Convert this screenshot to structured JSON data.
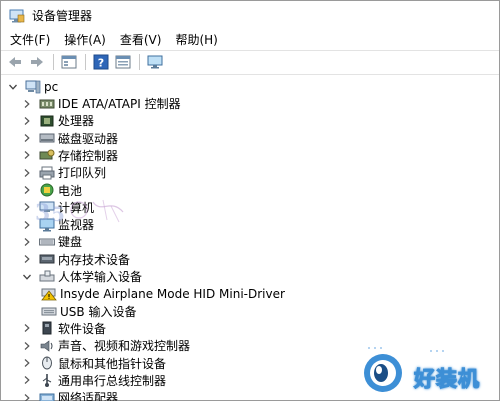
{
  "window": {
    "title": "设备管理器"
  },
  "menu": [
    "文件(F)",
    "操作(A)",
    "查看(V)",
    "帮助(H)"
  ],
  "toolbar": {
    "icons": [
      "back-arrow-icon",
      "forward-arrow-icon",
      "properties-icon",
      "help-icon",
      "view-icon",
      "monitor-icon"
    ]
  },
  "tree": {
    "root": "pc",
    "categories": [
      {
        "label": "IDE ATA/ATAPI 控制器",
        "icon": "ide-controller-icon",
        "expanded": false
      },
      {
        "label": "处理器",
        "icon": "processor-icon",
        "expanded": false
      },
      {
        "label": "磁盘驱动器",
        "icon": "disk-drive-icon",
        "expanded": false
      },
      {
        "label": "存储控制器",
        "icon": "storage-controller-icon",
        "expanded": false
      },
      {
        "label": "打印队列",
        "icon": "printer-icon",
        "expanded": false
      },
      {
        "label": "电池",
        "icon": "battery-icon",
        "expanded": false
      },
      {
        "label": "计算机",
        "icon": "computer-icon",
        "expanded": false
      },
      {
        "label": "监视器",
        "icon": "monitor-icon",
        "expanded": false
      },
      {
        "label": "键盘",
        "icon": "keyboard-icon",
        "expanded": false
      },
      {
        "label": "内存技术设备",
        "icon": "memory-icon",
        "expanded": false
      },
      {
        "label": "人体学输入设备",
        "icon": "hid-icon",
        "expanded": true
      },
      {
        "label": "软件设备",
        "icon": "software-device-icon",
        "expanded": false
      },
      {
        "label": "声音、视频和游戏控制器",
        "icon": "sound-icon",
        "expanded": false
      },
      {
        "label": "鼠标和其他指针设备",
        "icon": "mouse-icon",
        "expanded": false
      },
      {
        "label": "通用串行总线控制器",
        "icon": "usb-icon",
        "expanded": false
      },
      {
        "label": "网络适配器",
        "icon": "network-icon",
        "expanded": false
      }
    ],
    "hid_children": [
      {
        "label": "Insyde Airplane Mode HID Mini-Driver",
        "icon": "warning-device-icon"
      },
      {
        "label": "USB 输入设备",
        "icon": "hid-device-icon"
      }
    ]
  },
  "brand": {
    "text": "好装机"
  },
  "colors": {
    "accent": "#3d8fd6",
    "warning": "#f2c200",
    "chevron": "#555555"
  }
}
